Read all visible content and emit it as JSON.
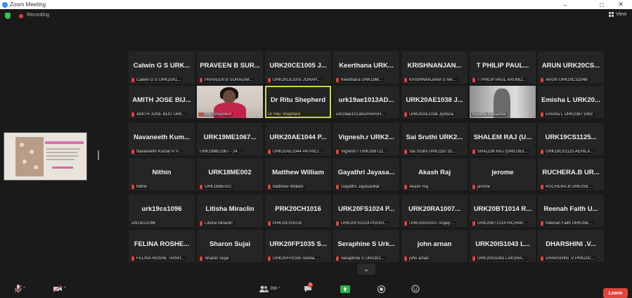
{
  "window": {
    "title": "Zoom Meeting",
    "controls": [
      "–",
      "□",
      "✕"
    ]
  },
  "topbar": {
    "recording_label": "Recording",
    "view_label": "View"
  },
  "gallery": {
    "tiles": [
      {
        "name": "Calwin G S URK...",
        "label": "Calwin G S URK20A1...",
        "muted": true
      },
      {
        "name": "PRAVEEN B SUR...",
        "label": "PRAVEEN B SURAGIM...",
        "muted": true
      },
      {
        "name": "URK20CE1005  J...",
        "label": "URK20CE1005 JONAH...",
        "muted": true
      },
      {
        "name": "Keerthana  URK...",
        "label": "Keerthana URK19M...",
        "muted": true
      },
      {
        "name": "KRISHNANJAN...",
        "label": "KRISHNANJANA S NA...",
        "muted": true
      },
      {
        "name": "T PHILIP PAUL...",
        "label": "T PHILIP PAUL ARUNO...",
        "muted": true
      },
      {
        "name": "ARUN URK20CS...",
        "label": "ARUN URK20CS2048",
        "muted": true
      },
      {
        "name": "AMITH JOSE BIJ...",
        "label": "AMITH JOSE BIJU URK...",
        "muted": true
      },
      {
        "name": "",
        "label": "Ritu Shepherd",
        "muted": true,
        "video": "ritu"
      },
      {
        "name": "Dr Ritu Shepherd",
        "label": "Dr Ritu Shepherd",
        "muted": false,
        "active": true
      },
      {
        "name": "urk19ae1013AD...",
        "label": "urk19ae1013ADHARSH...",
        "muted": false
      },
      {
        "name": "URK20AE1038  J...",
        "label": "URK20AE1038 Jyotsna",
        "muted": true
      },
      {
        "name": "",
        "label": "Kavitha Prasanna",
        "muted": false,
        "video": "kavitha"
      },
      {
        "name": "Emisha L URK20...",
        "label": "Emisha L URK20BT1063",
        "muted": true
      },
      {
        "name": "Navaneeth  Kum...",
        "label": "Navaneeth Kumar R P...",
        "muted": true
      },
      {
        "name": "URK19ME1067...",
        "label": "URK19ME1067 - 24 ...",
        "muted": false
      },
      {
        "name": "URK20AE1044  P...",
        "label": "URK20AE1044 PATRICI...",
        "muted": true
      },
      {
        "name": "Vignesh.r  URK2...",
        "label": "Vignesh.r URK20BT11...",
        "muted": true
      },
      {
        "name": "Sai Sruthi URK2...",
        "label": "Sai Sruthi URK21BT10...",
        "muted": true
      },
      {
        "name": "SHALEM RAJ (U...",
        "label": "SHALEM RAJ (URK19cs...",
        "muted": true
      },
      {
        "name": "URK19CS1125...",
        "label": "URK19CS1125 AEHILA...",
        "muted": true
      },
      {
        "name": "Nithin",
        "label": "Nithin",
        "muted": true
      },
      {
        "name": "URK18ME002",
        "label": "URK18ME002",
        "muted": true
      },
      {
        "name": "Matthew William",
        "label": "Matthew William",
        "muted": true
      },
      {
        "name": "Gayathri  Jayasa...",
        "label": "Gayathri Jayasankar",
        "muted": true
      },
      {
        "name": "Akash Raj",
        "label": "Akash Raj",
        "muted": true
      },
      {
        "name": "jerome",
        "label": "jerome",
        "muted": true
      },
      {
        "name": "RUCHERA.B  UR...",
        "label": "RUCHERA.B URK20B...",
        "muted": true
      },
      {
        "name": "urk19cs1096",
        "label": "urk19cs1096",
        "muted": false
      },
      {
        "name": "Litisha Miraclin",
        "label": "Litisha Miraclin",
        "muted": true
      },
      {
        "name": "PRK20CH1016",
        "label": "PRK20CH1016",
        "muted": true
      },
      {
        "name": "URK20FS1024  P...",
        "label": "URK20FS1024 POOVI...",
        "muted": true
      },
      {
        "name": "URK20RA1007...",
        "label": "URK20RA1007 Anjaly ...",
        "muted": true
      },
      {
        "name": "URK20BT1014  R...",
        "label": "URK20BT1014 RICHAR...",
        "muted": true
      },
      {
        "name": "Reenah Faith U...",
        "label": "Reenah Faith URK20B...",
        "muted": true
      },
      {
        "name": "FELINA ROSHE...",
        "label": "FELINA ROSHE TRISH...",
        "muted": true
      },
      {
        "name": "Sharon Sujai",
        "label": "Sharon Sujai",
        "muted": true
      },
      {
        "name": "URK20FP1035  S...",
        "label": "URK20FP1035 Sneha ...",
        "muted": true
      },
      {
        "name": "Seraphine S Urk...",
        "label": "Seraphine S Urk19c1...",
        "muted": true
      },
      {
        "name": "john arnan",
        "label": "john arnan",
        "muted": true
      },
      {
        "name": "URK20IS1043  L...",
        "label": "URK20IS1043 LAKSHA...",
        "muted": true
      },
      {
        "name": "DHARSHINI .V...",
        "label": "DHARSHINI .V PRK20C...",
        "muted": true
      }
    ],
    "scroll_glyph": "⌄"
  },
  "bottombar": {
    "participants_count": "266",
    "chat_badge": "5",
    "leave_label": "Leave"
  },
  "colors": {
    "background": "#1a1a1a",
    "tile": "#252525",
    "active_speaker": "#ccd64a",
    "muted_red": "#e0443c",
    "leave_red": "#e0443c"
  }
}
